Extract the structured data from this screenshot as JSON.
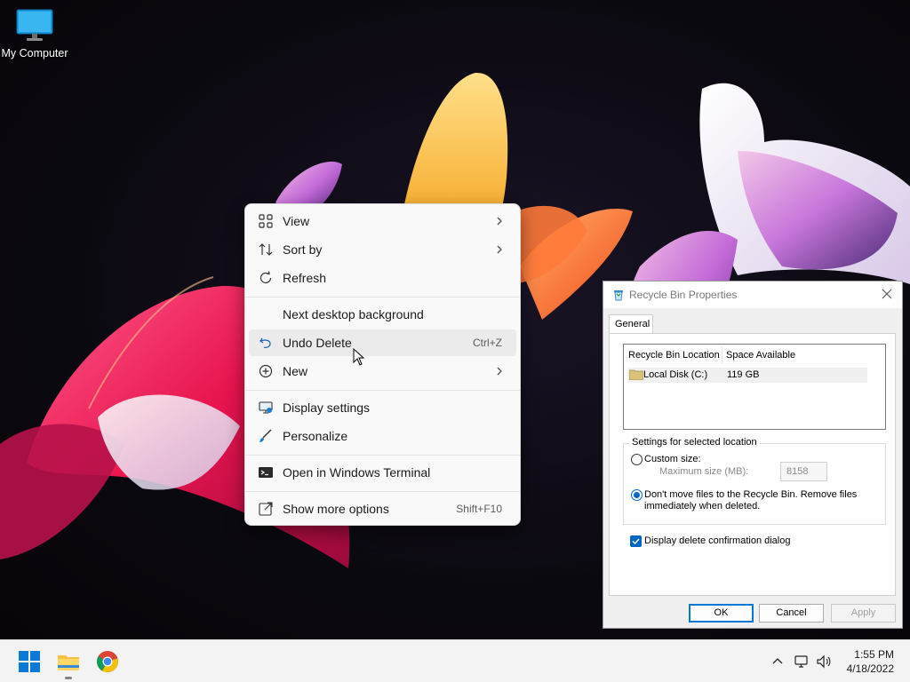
{
  "desktop": {
    "icons": [
      {
        "label": "My Computer",
        "icon": "monitor-icon"
      }
    ]
  },
  "context_menu": {
    "items": [
      {
        "label": "View",
        "icon": "grid-icon",
        "submenu": true,
        "shortcut": ""
      },
      {
        "label": "Sort by",
        "icon": "sort-icon",
        "submenu": true,
        "shortcut": ""
      },
      {
        "label": "Refresh",
        "icon": "refresh-icon",
        "submenu": false,
        "shortcut": ""
      },
      {
        "label": "Next desktop background",
        "icon": "",
        "submenu": false,
        "shortcut": ""
      },
      {
        "label": "Undo Delete",
        "icon": "undo-icon",
        "submenu": false,
        "shortcut": "Ctrl+Z",
        "hovered": true
      },
      {
        "label": "New",
        "icon": "plus-circle-icon",
        "submenu": true,
        "shortcut": ""
      },
      {
        "label": "Display settings",
        "icon": "display-icon",
        "submenu": false,
        "shortcut": ""
      },
      {
        "label": "Personalize",
        "icon": "brush-icon",
        "submenu": false,
        "shortcut": ""
      },
      {
        "label": "Open in Windows Terminal",
        "icon": "terminal-icon",
        "submenu": false,
        "shortcut": ""
      },
      {
        "label": "Show more options",
        "icon": "share-icon",
        "submenu": false,
        "shortcut": "Shift+F10"
      }
    ]
  },
  "dialog": {
    "title": "Recycle Bin Properties",
    "tab": "General",
    "list": {
      "columns": [
        "Recycle Bin Location",
        "Space Available"
      ],
      "rows": [
        {
          "location": "Local Disk (C:)",
          "space": "119 GB"
        }
      ]
    },
    "settings": {
      "group_label": "Settings for selected location",
      "custom_size_label": "Custom size:",
      "custom_size_selected": false,
      "max_size_label": "Maximum size (MB):",
      "max_size_value": "8158",
      "dont_move_line1": "Don't move files to the Recycle Bin. Remove files",
      "dont_move_line2": "immediately when deleted.",
      "dont_move_selected": true
    },
    "confirm_label": "Display delete confirmation dialog",
    "confirm_checked": true,
    "buttons": {
      "ok": "OK",
      "cancel": "Cancel",
      "apply": "Apply"
    }
  },
  "taskbar": {
    "apps": [
      "windows-start-icon",
      "file-explorer-icon",
      "chrome-icon"
    ],
    "tray": [
      "chevron-up-icon",
      "network-icon",
      "volume-icon"
    ],
    "time": "1:55 PM",
    "date": "4/18/2022"
  }
}
